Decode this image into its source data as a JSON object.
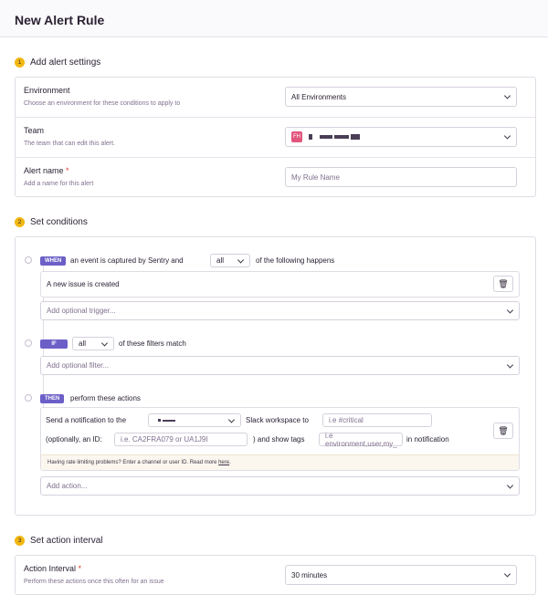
{
  "page": {
    "title": "New Alert Rule"
  },
  "steps": [
    {
      "num": "1",
      "label": "Add alert settings"
    },
    {
      "num": "2",
      "label": "Set conditions"
    },
    {
      "num": "3",
      "label": "Set action interval"
    }
  ],
  "settings": {
    "environment": {
      "label": "Environment",
      "help": "Choose an environment for these conditions to apply to",
      "value": "All Environments"
    },
    "team": {
      "label": "Team",
      "help": "The team that can edit this alert.",
      "avatar": "FH"
    },
    "alert_name": {
      "label": "Alert name",
      "required": "*",
      "help": "Add a name for this alert",
      "placeholder": "My Rule Name"
    }
  },
  "conditions": {
    "when": {
      "tag": "WHEN",
      "text_before": "an event is captured by Sentry and",
      "match": "all",
      "text_after": "of the following happens"
    },
    "trigger_item": "A new issue is created",
    "add_trigger": "Add optional trigger...",
    "if": {
      "tag": "IF",
      "match": "all",
      "text_after": "of these filters match"
    },
    "add_filter": "Add optional filter...",
    "then": {
      "tag": "THEN",
      "text_after": "perform these actions"
    },
    "action": {
      "send_text": "Send a notification to the",
      "workspace_text": "Slack workspace to",
      "channel_placeholder": "i.e #critical",
      "optional_id_text": "(optionally, an ID:",
      "id_placeholder": "i.e. CA2FRA079 or UA1J9I",
      "tags_text": ") and show tags",
      "tags_placeholder": "i.e environment,user,my_",
      "in_notification": "in notification",
      "banner_text": "Having rate limiting problems? Enter a channel or user ID. Read more",
      "banner_link": "here",
      "banner_end": "."
    },
    "add_action": "Add action..."
  },
  "interval": {
    "label": "Action Interval",
    "required": "*",
    "help": "Perform these actions once this often for an issue",
    "value": "30 minutes"
  },
  "colors": {
    "accent": "#6c5fc7",
    "step": "#f2b712",
    "avatar": "#e1567c"
  }
}
